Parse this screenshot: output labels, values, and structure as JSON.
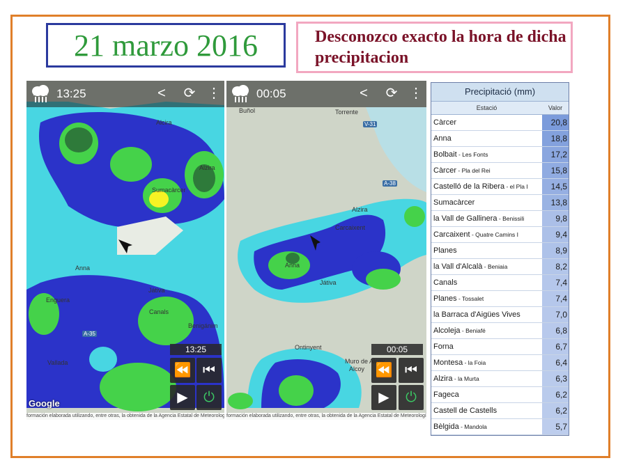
{
  "header": {
    "date": "21 marzo 2016",
    "note": "Desconozco exacto la hora de dicha precipitacion"
  },
  "phones": [
    {
      "time": "13:25",
      "player_time": "13:25",
      "labels": [
        "Alcira",
        "Sumacàrcer",
        "Anna",
        "Játiva",
        "Enguera",
        "Canals",
        "Benigánim",
        "Vallada",
        "Alzira"
      ],
      "roads": [
        "A-35"
      ]
    },
    {
      "time": "00:05",
      "player_time": "00:05",
      "labels": [
        "Buñol",
        "Torrente",
        "Alzira",
        "Carcaixent",
        "Anna",
        "Játiva",
        "Ontinyent",
        "Muro de Alcoy",
        "Alcoy"
      ],
      "roads": [
        "V-31",
        "A-38"
      ]
    }
  ],
  "map_footer": "formación elaborada utilizando, entre otras, la obtenida de la Agencia Estatal de Meteorología",
  "google": "Google",
  "table": {
    "title": "Precipitació (mm)",
    "col_station": "Estació",
    "col_value": "Valor",
    "rows": [
      {
        "name": "Càrcer",
        "sub": "",
        "value": "20,8",
        "level": 1.0
      },
      {
        "name": "Anna",
        "sub": "",
        "value": "18,8",
        "level": 0.9
      },
      {
        "name": "Bolbait",
        "sub": " - Les Fonts",
        "value": "17,2",
        "level": 0.83
      },
      {
        "name": "Càrcer",
        "sub": " - Pla del Rei",
        "value": "15,8",
        "level": 0.76
      },
      {
        "name": "Castelló de la Ribera",
        "sub": " - el Pla I",
        "value": "14,5",
        "level": 0.7
      },
      {
        "name": "Sumacàrcer",
        "sub": "",
        "value": "13,8",
        "level": 0.66
      },
      {
        "name": "la Vall de Gallinera",
        "sub": " - Benissili",
        "value": "9,8",
        "level": 0.47
      },
      {
        "name": "Carcaixent",
        "sub": " - Quatre Camins I",
        "value": "9,4",
        "level": 0.45
      },
      {
        "name": "Planes",
        "sub": "",
        "value": "8,9",
        "level": 0.43
      },
      {
        "name": "la Vall d'Alcalà",
        "sub": " - Beniaia",
        "value": "8,2",
        "level": 0.39
      },
      {
        "name": "Canals",
        "sub": "",
        "value": "7,4",
        "level": 0.36
      },
      {
        "name": "Planes",
        "sub": " - Tossalet",
        "value": "7,4",
        "level": 0.36
      },
      {
        "name": "la Barraca d'Aigües Vives",
        "sub": "",
        "value": "7,0",
        "level": 0.34
      },
      {
        "name": "Alcoleja",
        "sub": " - Beniafé",
        "value": "6,8",
        "level": 0.33
      },
      {
        "name": "Forna",
        "sub": "",
        "value": "6,7",
        "level": 0.32
      },
      {
        "name": "Montesa",
        "sub": " - la Foia",
        "value": "6,4",
        "level": 0.31
      },
      {
        "name": "Alzira",
        "sub": " - la Murta",
        "value": "6,3",
        "level": 0.3
      },
      {
        "name": "Fageca",
        "sub": "",
        "value": "6,2",
        "level": 0.3
      },
      {
        "name": "Castell de Castells",
        "sub": "",
        "value": "6,2",
        "level": 0.3
      },
      {
        "name": "Bèlgida",
        "sub": " - Mandola",
        "value": "5,7",
        "level": 0.27
      }
    ]
  },
  "colors": {
    "frame": "#e07f2a",
    "date_border": "#2b3a9e",
    "date_text": "#2f9a3b",
    "note_border": "#f2a7c0",
    "note_text": "#7a1228",
    "radar_light": "#48d6e2",
    "radar_dark": "#2b33c9",
    "radar_green": "#45d24a",
    "radar_dark_green": "#2e7a3a",
    "radar_yellow": "#f6f324"
  },
  "icons": [
    "rain-cloud-icon",
    "share-icon",
    "refresh-icon",
    "more-vert-icon",
    "rewind-icon",
    "skip-back-icon",
    "play-icon",
    "power-icon",
    "location-arrow-icon"
  ]
}
